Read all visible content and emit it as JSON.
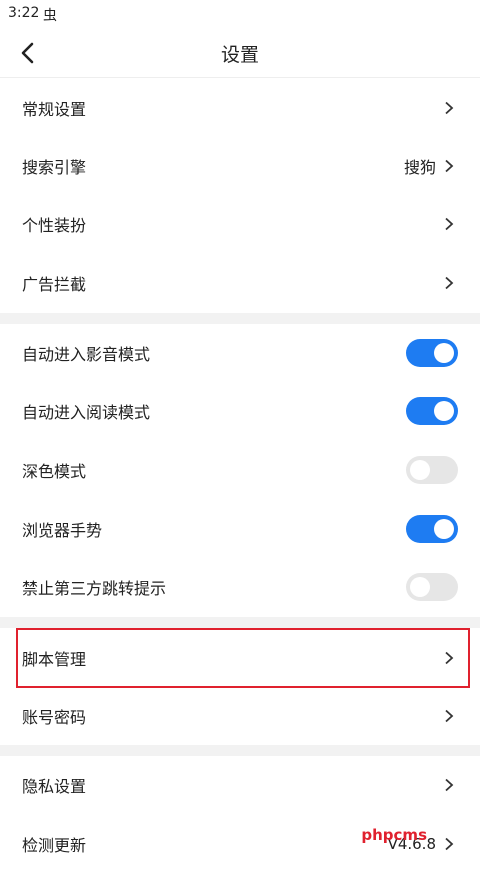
{
  "status_bar": {
    "time": "3:22",
    "notification": "虫"
  },
  "nav": {
    "title": "设置"
  },
  "section1": [
    {
      "label": "常规设置",
      "value": ""
    },
    {
      "label": "搜索引擎",
      "value": "搜狗"
    },
    {
      "label": "个性装扮",
      "value": ""
    },
    {
      "label": "广告拦截",
      "value": ""
    }
  ],
  "section2": [
    {
      "label": "自动进入影音模式",
      "on": true
    },
    {
      "label": "自动进入阅读模式",
      "on": true
    },
    {
      "label": "深色模式",
      "on": false
    },
    {
      "label": "浏览器手势",
      "on": true
    },
    {
      "label": "禁止第三方跳转提示",
      "on": false
    }
  ],
  "section3": [
    {
      "label": "脚本管理",
      "value": ""
    },
    {
      "label": "账号密码",
      "value": ""
    }
  ],
  "section4": [
    {
      "label": "隐私设置",
      "value": ""
    },
    {
      "label": "检测更新",
      "value": "V4.6.8"
    }
  ],
  "watermark": "phpcms",
  "colors": {
    "toggle_on": "#1e7cf2",
    "toggle_off": "#e6e6e6",
    "highlight": "#e0212e"
  }
}
